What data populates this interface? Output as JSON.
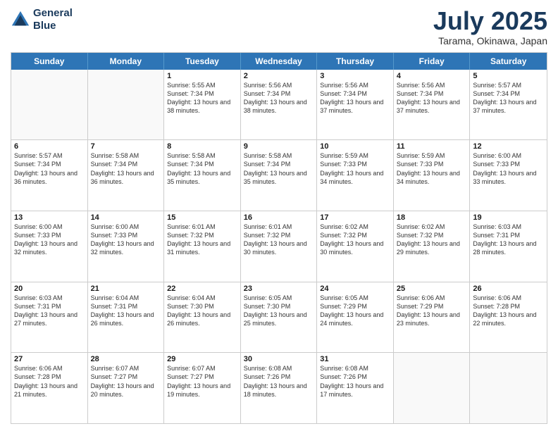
{
  "header": {
    "logo_line1": "General",
    "logo_line2": "Blue",
    "month": "July 2025",
    "location": "Tarama, Okinawa, Japan"
  },
  "weekdays": [
    "Sunday",
    "Monday",
    "Tuesday",
    "Wednesday",
    "Thursday",
    "Friday",
    "Saturday"
  ],
  "rows": [
    [
      {
        "day": "",
        "sunrise": "",
        "sunset": "",
        "daylight": ""
      },
      {
        "day": "",
        "sunrise": "",
        "sunset": "",
        "daylight": ""
      },
      {
        "day": "1",
        "sunrise": "Sunrise: 5:55 AM",
        "sunset": "Sunset: 7:34 PM",
        "daylight": "Daylight: 13 hours and 38 minutes."
      },
      {
        "day": "2",
        "sunrise": "Sunrise: 5:56 AM",
        "sunset": "Sunset: 7:34 PM",
        "daylight": "Daylight: 13 hours and 38 minutes."
      },
      {
        "day": "3",
        "sunrise": "Sunrise: 5:56 AM",
        "sunset": "Sunset: 7:34 PM",
        "daylight": "Daylight: 13 hours and 37 minutes."
      },
      {
        "day": "4",
        "sunrise": "Sunrise: 5:56 AM",
        "sunset": "Sunset: 7:34 PM",
        "daylight": "Daylight: 13 hours and 37 minutes."
      },
      {
        "day": "5",
        "sunrise": "Sunrise: 5:57 AM",
        "sunset": "Sunset: 7:34 PM",
        "daylight": "Daylight: 13 hours and 37 minutes."
      }
    ],
    [
      {
        "day": "6",
        "sunrise": "Sunrise: 5:57 AM",
        "sunset": "Sunset: 7:34 PM",
        "daylight": "Daylight: 13 hours and 36 minutes."
      },
      {
        "day": "7",
        "sunrise": "Sunrise: 5:58 AM",
        "sunset": "Sunset: 7:34 PM",
        "daylight": "Daylight: 13 hours and 36 minutes."
      },
      {
        "day": "8",
        "sunrise": "Sunrise: 5:58 AM",
        "sunset": "Sunset: 7:34 PM",
        "daylight": "Daylight: 13 hours and 35 minutes."
      },
      {
        "day": "9",
        "sunrise": "Sunrise: 5:58 AM",
        "sunset": "Sunset: 7:34 PM",
        "daylight": "Daylight: 13 hours and 35 minutes."
      },
      {
        "day": "10",
        "sunrise": "Sunrise: 5:59 AM",
        "sunset": "Sunset: 7:33 PM",
        "daylight": "Daylight: 13 hours and 34 minutes."
      },
      {
        "day": "11",
        "sunrise": "Sunrise: 5:59 AM",
        "sunset": "Sunset: 7:33 PM",
        "daylight": "Daylight: 13 hours and 34 minutes."
      },
      {
        "day": "12",
        "sunrise": "Sunrise: 6:00 AM",
        "sunset": "Sunset: 7:33 PM",
        "daylight": "Daylight: 13 hours and 33 minutes."
      }
    ],
    [
      {
        "day": "13",
        "sunrise": "Sunrise: 6:00 AM",
        "sunset": "Sunset: 7:33 PM",
        "daylight": "Daylight: 13 hours and 32 minutes."
      },
      {
        "day": "14",
        "sunrise": "Sunrise: 6:00 AM",
        "sunset": "Sunset: 7:33 PM",
        "daylight": "Daylight: 13 hours and 32 minutes."
      },
      {
        "day": "15",
        "sunrise": "Sunrise: 6:01 AM",
        "sunset": "Sunset: 7:32 PM",
        "daylight": "Daylight: 13 hours and 31 minutes."
      },
      {
        "day": "16",
        "sunrise": "Sunrise: 6:01 AM",
        "sunset": "Sunset: 7:32 PM",
        "daylight": "Daylight: 13 hours and 30 minutes."
      },
      {
        "day": "17",
        "sunrise": "Sunrise: 6:02 AM",
        "sunset": "Sunset: 7:32 PM",
        "daylight": "Daylight: 13 hours and 30 minutes."
      },
      {
        "day": "18",
        "sunrise": "Sunrise: 6:02 AM",
        "sunset": "Sunset: 7:32 PM",
        "daylight": "Daylight: 13 hours and 29 minutes."
      },
      {
        "day": "19",
        "sunrise": "Sunrise: 6:03 AM",
        "sunset": "Sunset: 7:31 PM",
        "daylight": "Daylight: 13 hours and 28 minutes."
      }
    ],
    [
      {
        "day": "20",
        "sunrise": "Sunrise: 6:03 AM",
        "sunset": "Sunset: 7:31 PM",
        "daylight": "Daylight: 13 hours and 27 minutes."
      },
      {
        "day": "21",
        "sunrise": "Sunrise: 6:04 AM",
        "sunset": "Sunset: 7:31 PM",
        "daylight": "Daylight: 13 hours and 26 minutes."
      },
      {
        "day": "22",
        "sunrise": "Sunrise: 6:04 AM",
        "sunset": "Sunset: 7:30 PM",
        "daylight": "Daylight: 13 hours and 26 minutes."
      },
      {
        "day": "23",
        "sunrise": "Sunrise: 6:05 AM",
        "sunset": "Sunset: 7:30 PM",
        "daylight": "Daylight: 13 hours and 25 minutes."
      },
      {
        "day": "24",
        "sunrise": "Sunrise: 6:05 AM",
        "sunset": "Sunset: 7:29 PM",
        "daylight": "Daylight: 13 hours and 24 minutes."
      },
      {
        "day": "25",
        "sunrise": "Sunrise: 6:06 AM",
        "sunset": "Sunset: 7:29 PM",
        "daylight": "Daylight: 13 hours and 23 minutes."
      },
      {
        "day": "26",
        "sunrise": "Sunrise: 6:06 AM",
        "sunset": "Sunset: 7:28 PM",
        "daylight": "Daylight: 13 hours and 22 minutes."
      }
    ],
    [
      {
        "day": "27",
        "sunrise": "Sunrise: 6:06 AM",
        "sunset": "Sunset: 7:28 PM",
        "daylight": "Daylight: 13 hours and 21 minutes."
      },
      {
        "day": "28",
        "sunrise": "Sunrise: 6:07 AM",
        "sunset": "Sunset: 7:27 PM",
        "daylight": "Daylight: 13 hours and 20 minutes."
      },
      {
        "day": "29",
        "sunrise": "Sunrise: 6:07 AM",
        "sunset": "Sunset: 7:27 PM",
        "daylight": "Daylight: 13 hours and 19 minutes."
      },
      {
        "day": "30",
        "sunrise": "Sunrise: 6:08 AM",
        "sunset": "Sunset: 7:26 PM",
        "daylight": "Daylight: 13 hours and 18 minutes."
      },
      {
        "day": "31",
        "sunrise": "Sunrise: 6:08 AM",
        "sunset": "Sunset: 7:26 PM",
        "daylight": "Daylight: 13 hours and 17 minutes."
      },
      {
        "day": "",
        "sunrise": "",
        "sunset": "",
        "daylight": ""
      },
      {
        "day": "",
        "sunrise": "",
        "sunset": "",
        "daylight": ""
      }
    ]
  ]
}
